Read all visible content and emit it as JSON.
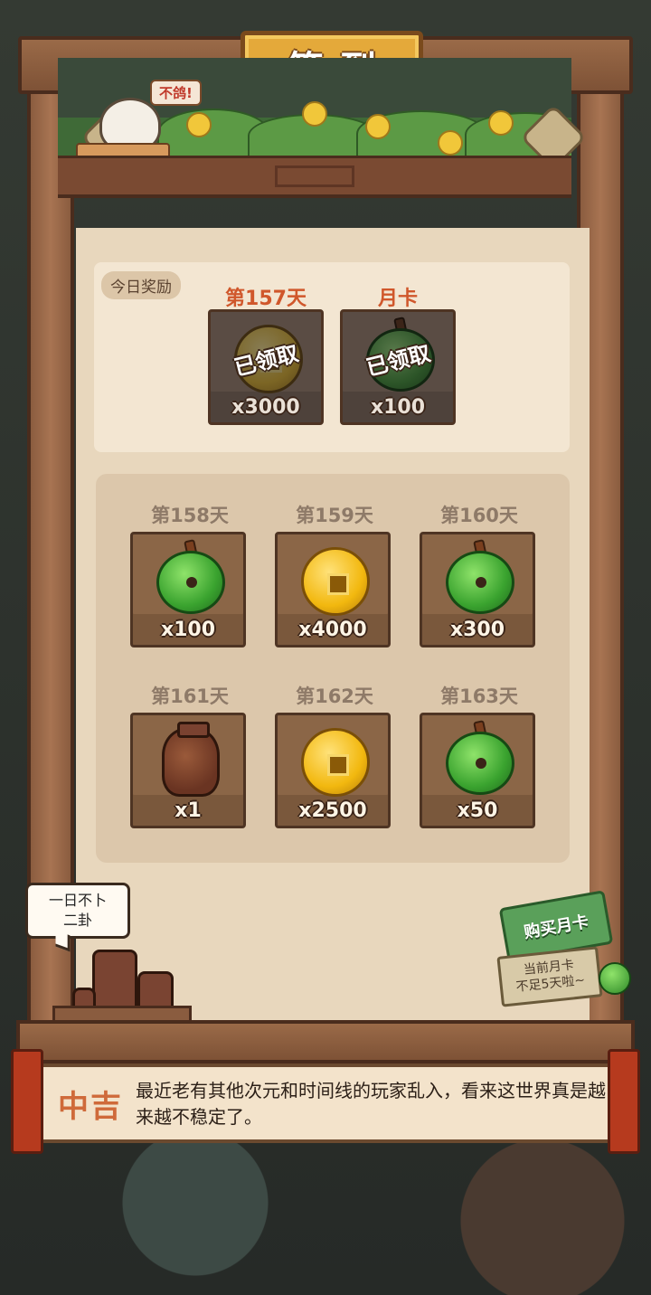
{
  "header": {
    "title": "签到"
  },
  "banner": {
    "chicken_bubble": "不鸽!"
  },
  "today": {
    "section_label": "今日奖励",
    "rewards": [
      {
        "day_label": "第157天",
        "item": "coin-icon",
        "quantity": "x3000",
        "status": "已领取"
      },
      {
        "day_label": "月卡",
        "item": "jade-icon",
        "quantity": "x100",
        "status": "已领取"
      }
    ]
  },
  "upcoming": [
    {
      "day_label": "第158天",
      "item": "jade-icon",
      "quantity": "x100"
    },
    {
      "day_label": "第159天",
      "item": "coin-icon",
      "quantity": "x4000"
    },
    {
      "day_label": "第160天",
      "item": "jade-icon",
      "quantity": "x300"
    },
    {
      "day_label": "第161天",
      "item": "jar-icon",
      "quantity": "x1"
    },
    {
      "day_label": "第162天",
      "item": "coin-icon",
      "quantity": "x2500"
    },
    {
      "day_label": "第163天",
      "item": "jade-icon",
      "quantity": "x50"
    }
  ],
  "speech_bubble": {
    "line1": "一日不卜",
    "line2": "二卦"
  },
  "monthly_card": {
    "button_label": "购买月卡",
    "note_line1": "当前月卡",
    "note_line2": "不足5天啦~"
  },
  "fortune": {
    "result": "中吉",
    "text": "最近老有其他次元和时间线的玩家乱入，看来这世界真是越来越不稳定了。"
  },
  "colors": {
    "highlight_label": "#d0572b",
    "muted_label": "#8e7a68",
    "paper": "#e8d7bd",
    "wood": "#8a5c3f"
  }
}
